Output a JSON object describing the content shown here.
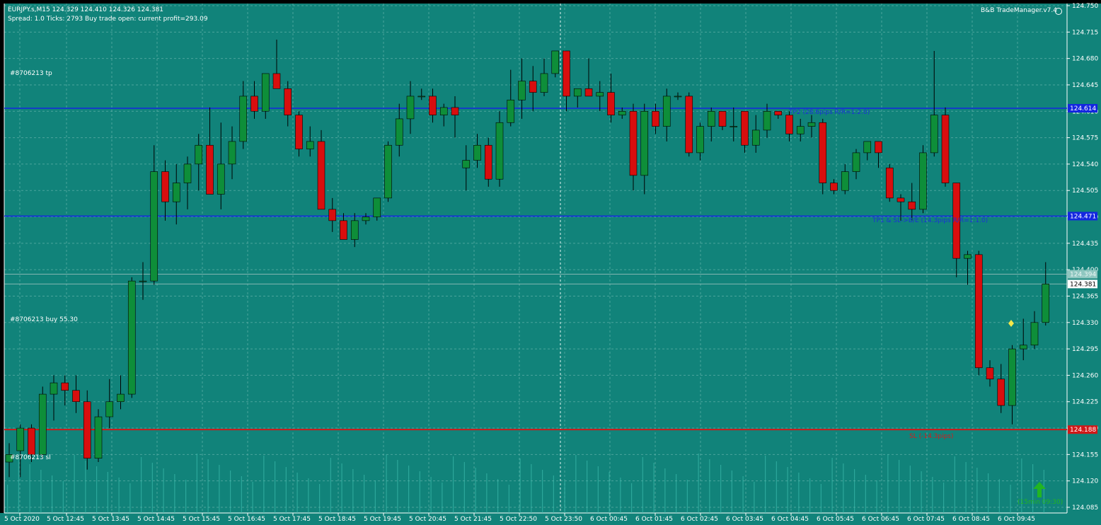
{
  "header": {
    "symbol_line": "EURJPY.s,M15  124.329 124.410 124.326 124.381",
    "info_line": "Spread: 1.0  Ticks: 2793  Buy trade open: current profit=293.09"
  },
  "indicator_label": "B&B TradeManager.v7.4",
  "trade_labels": {
    "tp": "#8706213 tp",
    "buy": "#8706213 buy 55.30",
    "sl": "#8706213 sl"
  },
  "line_labels": {
    "tp2": "TP2 (28.6pips R/R=1:2.0)",
    "tp1": "TP1 & SL->B/E (14.3pips R/R=1:1.0)",
    "sl": "SL (-14.3pips)"
  },
  "timer": "(15min 09:30)",
  "colors": {
    "background": "#11837A",
    "grid": "#5FB0A8",
    "bull": "#0E8E39",
    "bear": "#D80E0E",
    "wick": "#000000",
    "tp_line": "#1426E0",
    "sl_line": "#D01818",
    "tp_tag": "#1426E0",
    "sl_tag": "#D01818",
    "price_tag_bg": "#FFFFFF"
  },
  "chart_data": {
    "type": "candlestick",
    "symbol": "EURJPY.s",
    "timeframe": "M15",
    "ylim": [
      124.085,
      124.755
    ],
    "y_ticks": [
      "124.750",
      "124.715",
      "124.680",
      "124.645",
      "124.610",
      "124.575",
      "124.540",
      "124.505",
      "124.470",
      "124.435",
      "124.400",
      "124.365",
      "124.330",
      "124.295",
      "124.260",
      "124.225",
      "124.190",
      "124.155",
      "124.120",
      "124.085"
    ],
    "x_tick_labels": [
      "5 Oct 2020",
      "5 Oct 12:45",
      "5 Oct 13:45",
      "5 Oct 14:45",
      "5 Oct 15:45",
      "5 Oct 16:45",
      "5 Oct 17:45",
      "5 Oct 18:45",
      "5 Oct 19:45",
      "5 Oct 20:45",
      "5 Oct 21:45",
      "5 Oct 22:50",
      "5 Oct 23:50",
      "6 Oct 00:45",
      "6 Oct 01:45",
      "6 Oct 02:45",
      "6 Oct 03:45",
      "6 Oct 04:45",
      "6 Oct 05:45",
      "6 Oct 06:45",
      "6 Oct 07:45",
      "6 Oct 08:45",
      "6 Oct 09:45"
    ],
    "levels": {
      "tp2": "124.614",
      "tp1": "124.471",
      "entry": "124.394",
      "current": "124.381",
      "sl": "124.188"
    },
    "candles": [
      [
        124.145,
        124.17,
        124.125,
        124.155
      ],
      [
        124.16,
        124.195,
        124.125,
        124.19
      ],
      [
        124.19,
        124.195,
        124.145,
        124.155
      ],
      [
        124.155,
        124.245,
        124.15,
        124.235
      ],
      [
        124.235,
        124.26,
        124.2,
        124.25
      ],
      [
        124.25,
        124.26,
        124.22,
        124.24
      ],
      [
        124.24,
        124.26,
        124.21,
        124.225
      ],
      [
        124.225,
        124.24,
        124.135,
        124.15
      ],
      [
        124.15,
        124.215,
        124.145,
        124.205
      ],
      [
        124.205,
        124.255,
        124.19,
        124.225
      ],
      [
        124.225,
        124.26,
        124.215,
        124.235
      ],
      [
        124.235,
        124.39,
        124.23,
        124.385
      ],
      [
        124.385,
        124.41,
        124.36,
        124.385
      ],
      [
        124.385,
        124.565,
        124.38,
        124.53
      ],
      [
        124.53,
        124.545,
        124.465,
        124.49
      ],
      [
        124.49,
        124.54,
        124.46,
        124.515
      ],
      [
        124.515,
        124.55,
        124.48,
        124.54
      ],
      [
        124.54,
        124.58,
        124.505,
        124.565
      ],
      [
        124.565,
        124.615,
        124.505,
        124.5
      ],
      [
        124.5,
        124.595,
        124.48,
        124.54
      ],
      [
        124.54,
        124.59,
        124.52,
        124.57
      ],
      [
        124.57,
        124.65,
        124.56,
        124.63
      ],
      [
        124.63,
        124.65,
        124.6,
        124.61
      ],
      [
        124.61,
        124.66,
        124.6,
        124.66
      ],
      [
        124.66,
        124.705,
        124.64,
        124.64
      ],
      [
        124.64,
        124.65,
        124.59,
        124.605
      ],
      [
        124.605,
        124.61,
        124.55,
        124.56
      ],
      [
        124.56,
        124.59,
        124.55,
        124.57
      ],
      [
        124.57,
        124.585,
        124.48,
        124.48
      ],
      [
        124.48,
        124.495,
        124.45,
        124.465
      ],
      [
        124.465,
        124.475,
        124.445,
        124.44
      ],
      [
        124.44,
        124.475,
        124.43,
        124.465
      ],
      [
        124.465,
        124.475,
        124.46,
        124.47
      ],
      [
        124.47,
        124.495,
        124.465,
        124.495
      ],
      [
        124.495,
        124.57,
        124.49,
        124.565
      ],
      [
        124.565,
        124.62,
        124.55,
        124.6
      ],
      [
        124.6,
        124.65,
        124.58,
        124.63
      ],
      [
        124.63,
        124.64,
        124.625,
        124.63
      ],
      [
        124.63,
        124.64,
        124.595,
        124.605
      ],
      [
        124.605,
        124.62,
        124.59,
        124.615
      ],
      [
        124.615,
        124.63,
        124.575,
        124.605
      ],
      [
        124.535,
        124.565,
        124.505,
        124.545
      ],
      [
        124.545,
        124.58,
        124.535,
        124.565
      ],
      [
        124.565,
        124.575,
        124.51,
        124.52
      ],
      [
        124.52,
        124.61,
        124.51,
        124.595
      ],
      [
        124.595,
        124.665,
        124.59,
        124.625
      ],
      [
        124.625,
        124.68,
        124.6,
        124.65
      ],
      [
        124.65,
        124.67,
        124.61,
        124.635
      ],
      [
        124.635,
        124.68,
        124.63,
        124.66
      ],
      [
        124.66,
        124.69,
        124.655,
        124.69
      ],
      [
        124.69,
        124.69,
        124.61,
        124.63
      ],
      [
        124.63,
        124.64,
        124.615,
        124.64
      ],
      [
        124.64,
        124.68,
        124.63,
        124.63
      ],
      [
        124.63,
        124.65,
        124.61,
        124.635
      ],
      [
        124.635,
        124.66,
        124.595,
        124.605
      ],
      [
        124.605,
        124.615,
        124.6,
        124.61
      ],
      [
        124.61,
        124.62,
        124.505,
        124.525
      ],
      [
        124.525,
        124.62,
        124.5,
        124.61
      ],
      [
        124.61,
        124.62,
        124.58,
        124.59
      ],
      [
        124.59,
        124.64,
        124.57,
        124.63
      ],
      [
        124.63,
        124.635,
        124.625,
        124.63
      ],
      [
        124.63,
        124.635,
        124.55,
        124.555
      ],
      [
        124.555,
        124.595,
        124.545,
        124.59
      ],
      [
        124.59,
        124.615,
        124.57,
        124.61
      ],
      [
        124.61,
        124.61,
        124.585,
        124.59
      ],
      [
        124.59,
        124.615,
        124.57,
        124.59
      ],
      [
        124.61,
        124.605,
        124.555,
        124.565
      ],
      [
        124.565,
        124.605,
        124.555,
        124.585
      ],
      [
        124.585,
        124.62,
        124.575,
        124.61
      ],
      [
        124.61,
        124.61,
        124.6,
        124.605
      ],
      [
        124.605,
        124.61,
        124.57,
        124.58
      ],
      [
        124.58,
        124.6,
        124.57,
        124.59
      ],
      [
        124.59,
        124.605,
        124.575,
        124.595
      ],
      [
        124.595,
        124.6,
        124.5,
        124.515
      ],
      [
        124.515,
        124.52,
        124.5,
        124.505
      ],
      [
        124.505,
        124.54,
        124.5,
        124.53
      ],
      [
        124.53,
        124.56,
        124.52,
        124.555
      ],
      [
        124.555,
        124.57,
        124.545,
        124.57
      ],
      [
        124.57,
        124.57,
        124.535,
        124.555
      ],
      [
        124.535,
        124.54,
        124.49,
        124.495
      ],
      [
        124.495,
        124.5,
        124.465,
        124.49
      ],
      [
        124.49,
        124.515,
        124.465,
        124.48
      ],
      [
        124.48,
        124.565,
        124.475,
        124.555
      ],
      [
        124.555,
        124.69,
        124.55,
        124.605
      ],
      [
        124.605,
        124.615,
        124.51,
        124.515
      ],
      [
        124.515,
        124.515,
        124.39,
        124.415
      ],
      [
        124.415,
        124.425,
        124.38,
        124.42
      ],
      [
        124.42,
        124.425,
        124.26,
        124.27
      ],
      [
        124.27,
        124.28,
        124.245,
        124.255
      ],
      [
        124.255,
        124.275,
        124.21,
        124.22
      ],
      [
        124.22,
        124.3,
        124.195,
        124.295
      ],
      [
        124.295,
        124.335,
        124.28,
        124.3
      ],
      [
        124.3,
        124.345,
        124.295,
        124.33
      ],
      [
        124.33,
        124.41,
        124.326,
        124.381
      ]
    ]
  }
}
